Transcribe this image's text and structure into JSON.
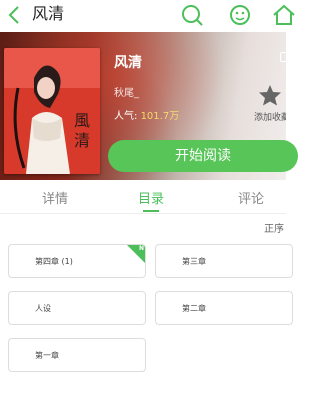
{
  "header": {
    "title": "风清"
  },
  "book": {
    "title": "风清",
    "author": "秋尾_",
    "popularity_label": "人气:",
    "popularity_value": "101.7万",
    "favorite_label": "添加收藏",
    "read_button": "开始阅读",
    "cover_text": "風清"
  },
  "tabs": [
    {
      "label": "详情"
    },
    {
      "label": "目录"
    },
    {
      "label": "评论"
    }
  ],
  "sort_label": "正序",
  "chapters": [
    {
      "title": "第四章 (1)",
      "badge": "N"
    },
    {
      "title": "第三章"
    },
    {
      "title": "人设"
    },
    {
      "title": "第二章"
    },
    {
      "title": "第一章"
    }
  ],
  "colors": {
    "accent": "#4cbf5a",
    "button": "#58c558"
  },
  "icons": [
    "back-icon",
    "search-icon",
    "face-icon",
    "home-icon",
    "star-icon"
  ]
}
